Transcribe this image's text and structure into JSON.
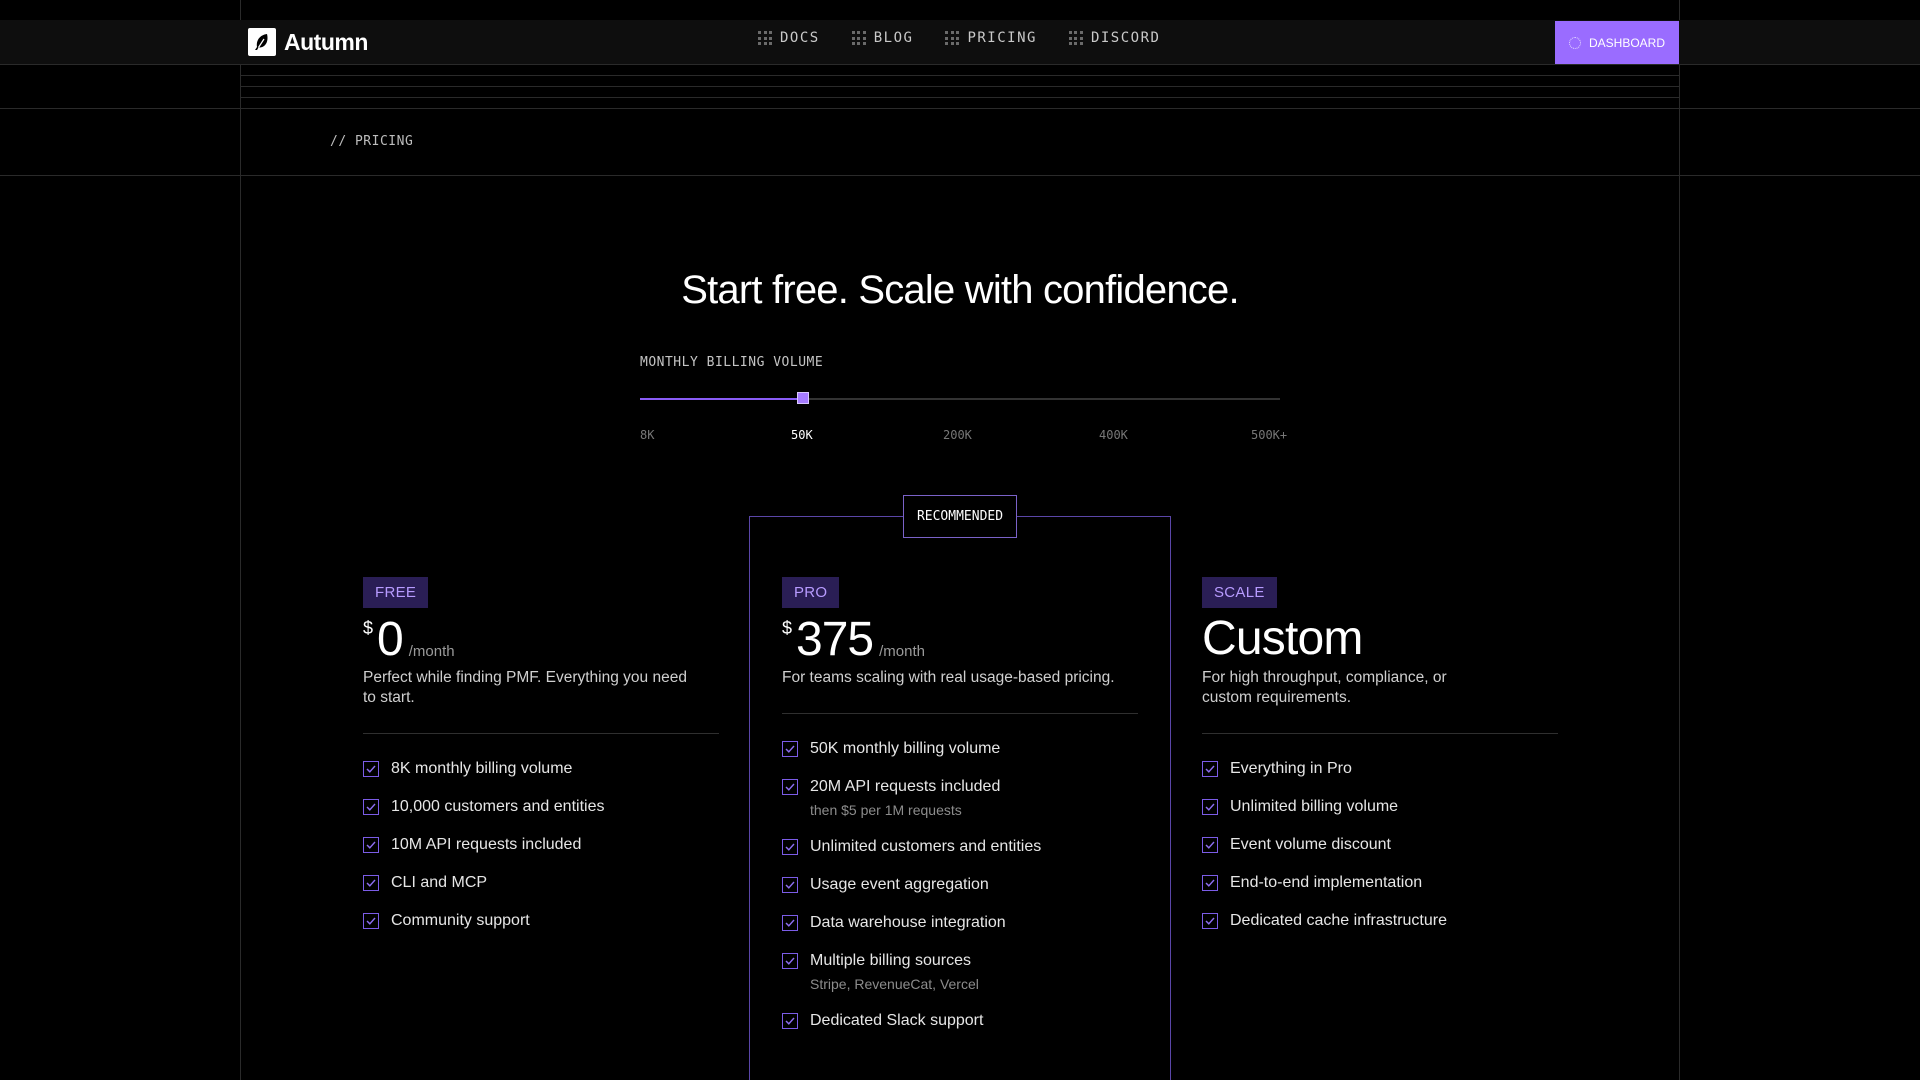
{
  "header": {
    "brand": "Autumn",
    "nav": [
      {
        "label": "DOCS",
        "icon": "docs-grid-icon"
      },
      {
        "label": "BLOG",
        "icon": "blog-grid-icon"
      },
      {
        "label": "PRICING",
        "icon": "pricing-grid-icon"
      },
      {
        "label": "DISCORD",
        "icon": "discord-grid-icon"
      }
    ],
    "dashboard_label": "DASHBOARD"
  },
  "breadcrumb": "// PRICING",
  "hero": {
    "title": "Start free. Scale with confidence."
  },
  "volume_slider": {
    "label": "MONTHLY BILLING VOLUME",
    "ticks": [
      "8K",
      "50K",
      "200K",
      "400K",
      "500K+"
    ],
    "selected": "50K",
    "selected_index": 1
  },
  "plans": {
    "free": {
      "tier": "FREE",
      "currency": "$",
      "amount": "0",
      "period": "/month",
      "description": "Perfect while finding PMF. Everything you need to start.",
      "features": [
        {
          "text": "8K monthly billing volume"
        },
        {
          "text": "10,000 customers and entities"
        },
        {
          "text": "10M API requests included"
        },
        {
          "text": "CLI and MCP"
        },
        {
          "text": "Community support"
        }
      ]
    },
    "pro": {
      "badge": "RECOMMENDED",
      "tier": "PRO",
      "currency": "$",
      "amount": "375",
      "period": "/month",
      "description": "For teams scaling with real usage-based pricing.",
      "features": [
        {
          "text": "50K monthly billing volume"
        },
        {
          "text": "20M API requests included",
          "sub": "then $5 per 1M requests"
        },
        {
          "text": "Unlimited customers and entities"
        },
        {
          "text": "Usage event aggregation"
        },
        {
          "text": "Data warehouse integration"
        },
        {
          "text": "Multiple billing sources",
          "sub": "Stripe, RevenueCat, Vercel"
        },
        {
          "text": "Dedicated Slack support"
        }
      ]
    },
    "scale": {
      "tier": "SCALE",
      "price_label": "Custom",
      "description": "For high throughput, compliance, or custom requirements.",
      "features": [
        {
          "text": "Everything in Pro"
        },
        {
          "text": "Unlimited billing volume"
        },
        {
          "text": "Event volume discount"
        },
        {
          "text": "End-to-end implementation"
        },
        {
          "text": "Dedicated cache infrastructure"
        }
      ]
    }
  },
  "colors": {
    "accent": "#9a6cff",
    "badge_bg": "#2a1e55",
    "badge_text": "#b79bff",
    "check": "#7b5ce6"
  }
}
